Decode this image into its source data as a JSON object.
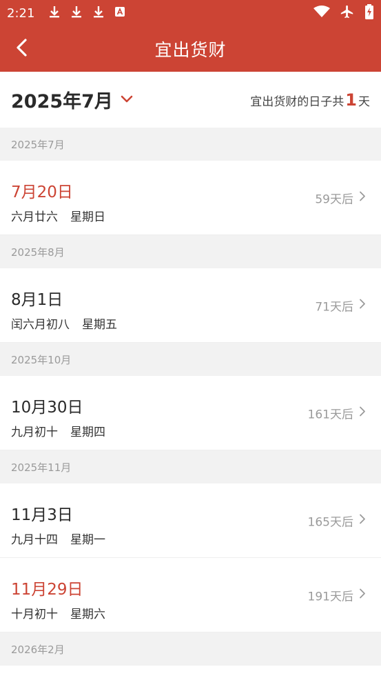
{
  "status_bar": {
    "time": "2:21"
  },
  "app_bar": {
    "title": "宜出货财"
  },
  "month_header": {
    "month": "2025年7月",
    "summary_prefix": "宜出货财的日子共",
    "summary_count": "1",
    "summary_suffix": "天"
  },
  "groups": [
    {
      "header": "2025年7月",
      "items": [
        {
          "date": "7月20日",
          "lunar": "六月廿六",
          "weekday": "星期日",
          "countdown": "59天后",
          "highlight": true
        }
      ]
    },
    {
      "header": "2025年8月",
      "items": [
        {
          "date": "8月1日",
          "lunar": "闰六月初八",
          "weekday": "星期五",
          "countdown": "71天后",
          "highlight": false
        }
      ]
    },
    {
      "header": "2025年10月",
      "items": [
        {
          "date": "10月30日",
          "lunar": "九月初十",
          "weekday": "星期四",
          "countdown": "161天后",
          "highlight": false
        }
      ]
    },
    {
      "header": "2025年11月",
      "items": [
        {
          "date": "11月3日",
          "lunar": "九月十四",
          "weekday": "星期一",
          "countdown": "165天后",
          "highlight": false
        },
        {
          "date": "11月29日",
          "lunar": "十月初十",
          "weekday": "星期六",
          "countdown": "191天后",
          "highlight": true
        }
      ]
    },
    {
      "header": "2026年2月",
      "items": []
    }
  ],
  "colors": {
    "brand": "#cc4434",
    "highlight_text": "#cc4434",
    "muted_text": "#9a9a9a"
  },
  "icons": {
    "back": "chevron-left-icon",
    "month_dropdown": "chevron-down-icon",
    "row_arrow": "chevron-right-icon",
    "status": [
      "download-icon",
      "download-icon",
      "download-icon",
      "font-a-icon",
      "wifi-icon",
      "airplane-icon",
      "battery-charging-icon"
    ]
  }
}
